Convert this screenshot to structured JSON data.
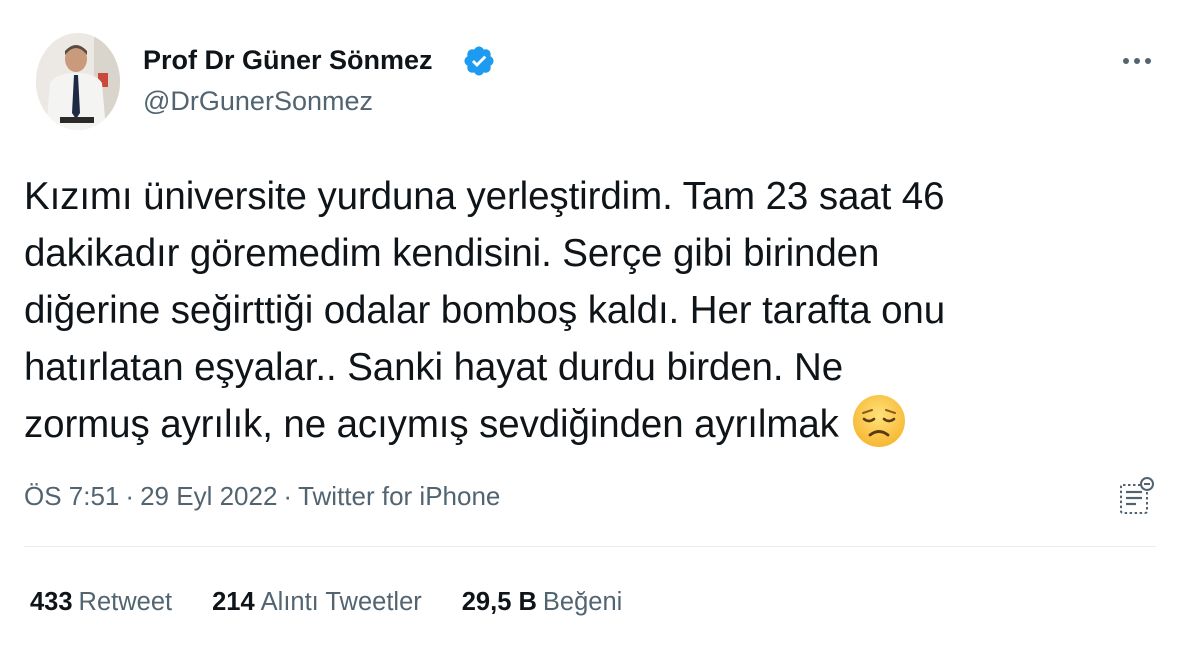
{
  "author": {
    "display_name": "Prof Dr Güner Sönmez",
    "handle": "@DrGunerSonmez",
    "verified": true,
    "verified_color": "#1d9bf0"
  },
  "tweet": {
    "lines": [
      "Kızımı üniversite yurduna yerleştirdim. Tam 23 saat 46",
      "dakikadır göremedim kendisini. Serçe gibi birinden",
      "diğerine seğirttiği odalar bomboş kaldı. Her tarafta onu",
      "hatırlatan eşyalar.. Sanki hayat durdu birden. Ne",
      "zormuş ayrılık, ne acıymış sevdiğinden ayrılmak"
    ],
    "emoji": "disappointed-face"
  },
  "meta": {
    "time": "ÖS 7:51",
    "separator": "·",
    "date": "29 Eyl 2022",
    "source": "Twitter for iPhone"
  },
  "stats": {
    "retweets": {
      "count": "433",
      "label": "Retweet"
    },
    "quotes": {
      "count": "214",
      "label": "Alıntı Tweetler"
    },
    "likes": {
      "count": "29,5 B",
      "label": "Beğeni"
    }
  },
  "icons": {
    "more": "more-horizontal-icon",
    "analytics": "analytics-icon"
  }
}
